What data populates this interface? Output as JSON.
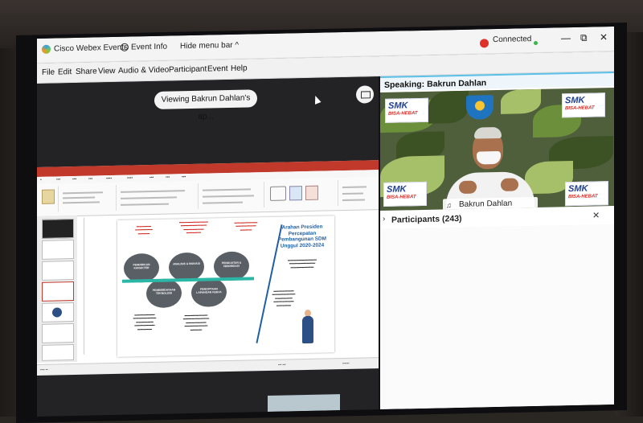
{
  "titlebar": {
    "app_name": "Cisco Webex Events",
    "event_info": "Event Info",
    "hide_menu": "Hide menu bar ^",
    "status": "Connected",
    "minimize": "—",
    "restore": "⧉",
    "close": "✕"
  },
  "menu": {
    "items": [
      "File",
      "Edit",
      "Share",
      "View",
      "Audio & Video",
      "Participant",
      "Event",
      "Help"
    ]
  },
  "stage": {
    "viewing_label": "Viewing Bakrun Dahlan's ap..."
  },
  "slide": {
    "title": "Arahan Presiden Percepatan Pembangunan SDM Unggul 2020-2024",
    "circles": [
      "PENDIDIKAN KARAKTER",
      "ANALISIS & INOVASI",
      "PENGUATAN & HIRORISASI",
      "PEMBERDAYAAN TEKNOLOGI",
      "PENCIPTAAN LAPANGAN KERJA"
    ]
  },
  "right_panel": {
    "speaking_prefix": "Speaking:",
    "speaker_name": "Bakrun Dahlan",
    "video_name": "Bakrun Dahlan",
    "smk_top": "SMK",
    "smk_bottom": "BISA-HEBAT",
    "participants_label": "Participants (243)",
    "participants_close": "✕"
  },
  "colors": {
    "accent": "#5bc0e8",
    "ppt_red": "#c0392b",
    "connected": "#e0302a"
  }
}
